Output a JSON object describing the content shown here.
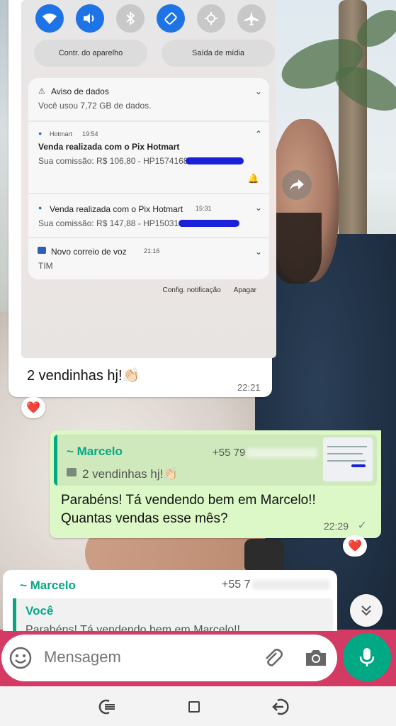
{
  "screenshot": {
    "quick_settings": [
      "wifi-icon",
      "volume-icon",
      "bluetooth-icon",
      "rotation-icon",
      "power-saving-icon",
      "airplane-icon"
    ],
    "device_control": "Contr. do aparelho",
    "media_output": "Saída de mídia",
    "notifications": [
      {
        "title": "Aviso de dados",
        "body": "Você usou 7,72 GB de dados."
      },
      {
        "app": "Hotmart",
        "time": "19:54",
        "title": "Venda realizada com o Pix Hotmart",
        "body": "Sua comissão: R$ 106,80 - HP1574168"
      },
      {
        "title": "Venda realizada com o Pix Hotmart",
        "time": "15:31",
        "body": "Sua comissão: R$ 147,88 - HP150316"
      },
      {
        "title": "Novo correio de voz",
        "time": "21:16",
        "body": "TIM"
      }
    ],
    "notif_settings": "Config. notificação",
    "clear": "Apagar"
  },
  "incoming_message": {
    "text": "2 vendinhas hj!👏🏻",
    "time": "22:21",
    "reaction": "❤️"
  },
  "outgoing_message": {
    "quote_name": "~ Marcelo",
    "quote_phone": "+55 79",
    "quote_text": "2 vendinhas hj!👏🏻",
    "text_line1": "Parabéns! Tá vendendo bem em Marcelo!!",
    "text_line2": "Quantas vendas esse mês?",
    "time": "22:29",
    "reaction": "❤️"
  },
  "incoming_reply": {
    "name": "~ Marcelo",
    "phone": "+55 7",
    "quote_name": "Você",
    "quote_text": "Parabéns! Tá vendendo bem em Marcelo!!"
  },
  "composer": {
    "placeholder": "Mensagem"
  },
  "colors": {
    "whatsapp_green": "#00a884",
    "bubble_out": "#dcf8c6",
    "scribble": "#1b21d8"
  }
}
